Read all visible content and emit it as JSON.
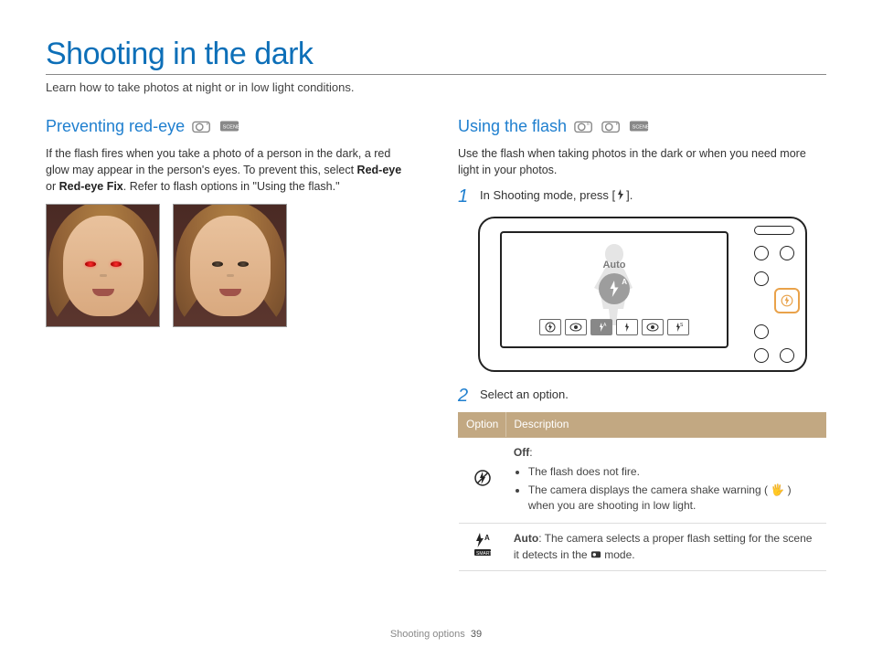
{
  "title": "Shooting in the dark",
  "subtitle": "Learn how to take photos at night or in low light conditions.",
  "left": {
    "heading": "Preventing red-eye",
    "body_pre": "If the flash fires when you take a photo of a person in the dark, a red glow may appear in the person's eyes. To prevent this, select ",
    "body_b1": "Red-eye",
    "body_mid": " or ",
    "body_b2": "Red-eye Fix",
    "body_post": ". Refer to flash options in \"Using the flash.\""
  },
  "right": {
    "heading": "Using the flash",
    "intro": "Use the flash when taking photos in the dark or when you need more light in your photos.",
    "step1_num": "1",
    "step1_pre": "In Shooting mode, press [",
    "step1_post": "].",
    "diagram": {
      "auto_label": "Auto"
    },
    "step2_num": "2",
    "step2_text": "Select an option.",
    "table": {
      "h1": "Option",
      "h2": "Description",
      "rows": [
        {
          "icon": "flash-off",
          "title": "Off",
          "bullets": [
            "The flash does not fire.",
            "The camera displays the camera shake warning ( 🖐 ) when you are shooting in low light."
          ]
        },
        {
          "icon": "flash-auto-smart",
          "title": "Auto",
          "desc_pre": ": The camera selects a proper flash setting for the scene it detects in the ",
          "desc_post": " mode."
        }
      ]
    }
  },
  "footer": {
    "section": "Shooting options",
    "page": "39"
  }
}
